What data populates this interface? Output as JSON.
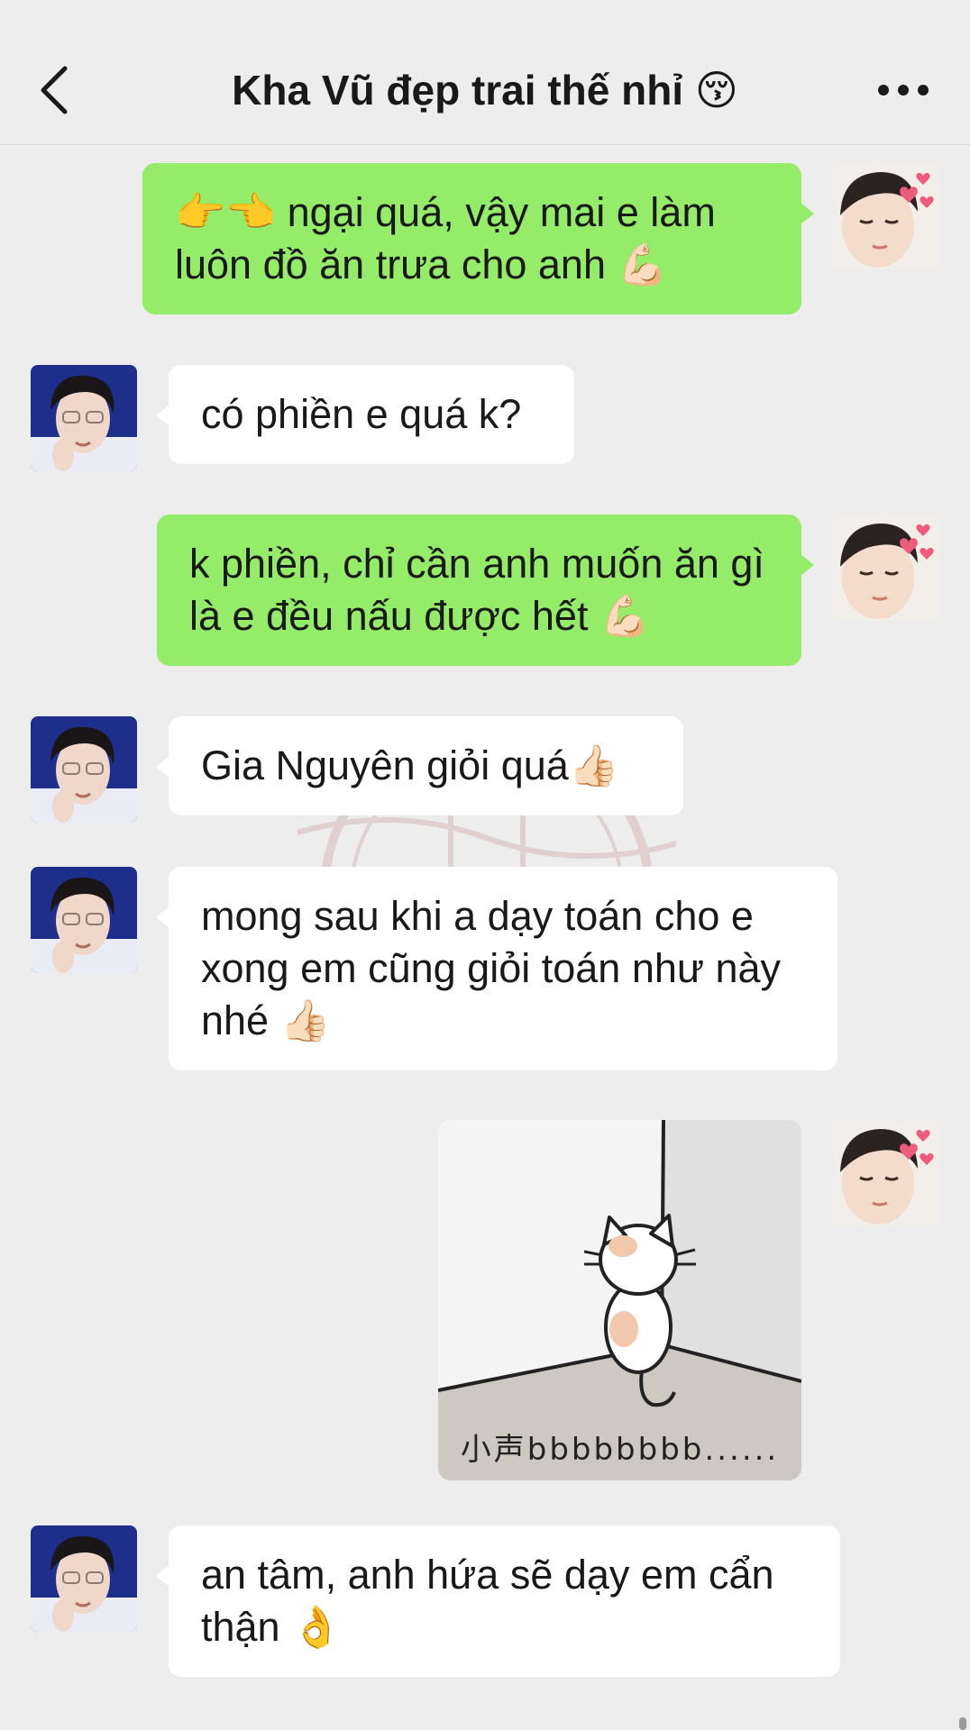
{
  "header": {
    "title": "Kha Vũ đẹp trai thế nhỉ 😚",
    "back_icon": "chevron-left-icon",
    "more_icon": "more-dots-icon"
  },
  "messages": [
    {
      "sender": "me",
      "text": "👉👈 ngại quá, vậy mai e làm luôn đồ ăn trưa cho anh 💪🏻"
    },
    {
      "sender": "them",
      "text": "có phiền e quá k?"
    },
    {
      "sender": "me",
      "text": "k phiền, chỉ cần anh muốn ăn gì là e đều nấu được hết 💪🏻"
    },
    {
      "sender": "them",
      "text": "Gia Nguyên giỏi quá👍🏻"
    },
    {
      "sender": "them",
      "text": "mong sau khi a dạy toán cho e xong em cũng giỏi toán như này nhé 👍🏻"
    },
    {
      "sender": "me",
      "type": "sticker",
      "caption": "小声bbbbbbbb......"
    },
    {
      "sender": "them",
      "text": "an tâm, anh hứa sẽ dạy em cẩn thận 👌"
    }
  ],
  "colors": {
    "background": "#ededed",
    "my_bubble": "#95ec69",
    "their_bubble": "#ffffff"
  }
}
